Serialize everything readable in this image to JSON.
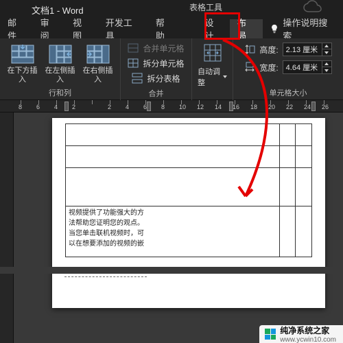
{
  "app": {
    "title": "文档1 - Word",
    "table_tools": "表格工具"
  },
  "tabs": {
    "mail": "邮件",
    "review": "审阅",
    "view": "视图",
    "devtools": "开发工具",
    "help": "帮助",
    "design": "设计",
    "layout": "布局",
    "tellme": "操作说明搜索"
  },
  "ribbon": {
    "rows_cols": {
      "insert_below": "在下方插入",
      "insert_left": "在左侧插入",
      "insert_right": "在右侧插入",
      "group": "行和列"
    },
    "merge": {
      "merge_cells": "合并单元格",
      "split_cells": "拆分单元格",
      "split_table": "拆分表格",
      "group": "合并"
    },
    "autofit": {
      "label": "自动调整"
    },
    "cellsize": {
      "height_label": "高度:",
      "height_val": "2.13 厘米",
      "width_label": "宽度:",
      "width_val": "4.64 厘米",
      "group": "单元格大小"
    }
  },
  "ruler": {
    "nums": [
      "8",
      "6",
      "4",
      "2",
      "",
      "2",
      "4",
      "6",
      "8",
      "10",
      "12",
      "14",
      "16",
      "18",
      "20",
      "22",
      "24",
      "26"
    ]
  },
  "doc": {
    "para": {
      "l1": "视频提供了功能强大的方",
      "l2": "法帮助您证明您的观点。",
      "l3": "当您单击联机视频时，可",
      "l4": "以在想要添加的视频的嵌"
    }
  },
  "watermark": {
    "brand": "纯净系统之家",
    "url": "www.ycwin10.com"
  }
}
